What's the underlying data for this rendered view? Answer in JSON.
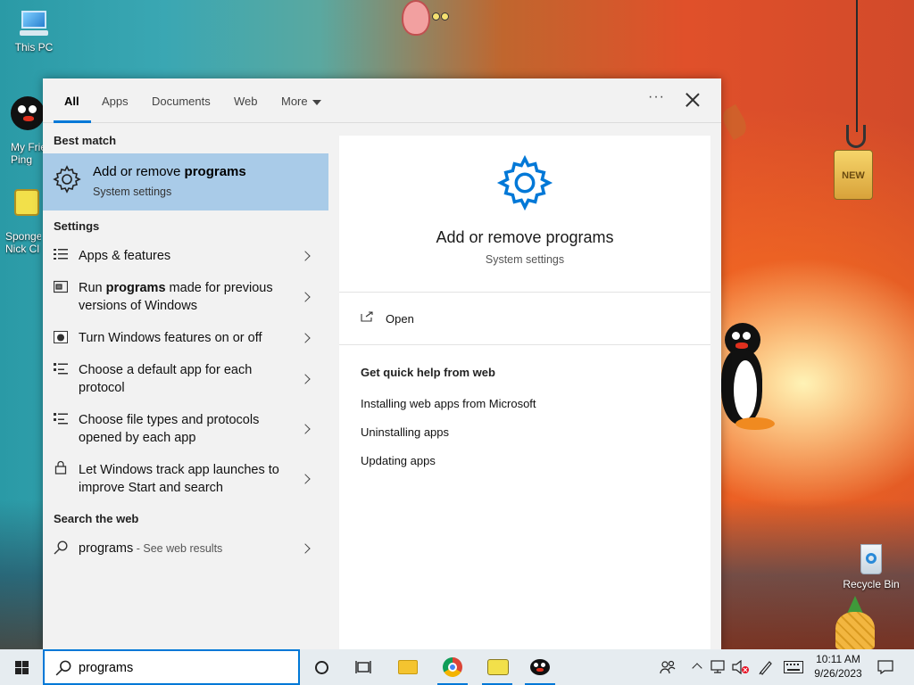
{
  "desktop": {
    "icons": {
      "this_pc": "This PC",
      "my_friend": "My Frie\nPing",
      "sponge": "Sponge\nNick Cl",
      "recycle_bin": "Recycle Bin"
    },
    "sign_text": "NEW"
  },
  "search_panel": {
    "tabs": [
      "All",
      "Apps",
      "Documents",
      "Web",
      "More"
    ],
    "active_tab": "All",
    "best_match": {
      "heading": "Best match",
      "title_plain": "Add or remove ",
      "title_bold": "programs",
      "subtitle": "System settings"
    },
    "settings": {
      "heading": "Settings",
      "items": [
        {
          "text": "Apps & features"
        },
        {
          "pre": "Run ",
          "bold": "programs",
          "post": " made for previous versions of Windows"
        },
        {
          "text": "Turn Windows features on or off"
        },
        {
          "text": "Choose a default app for each protocol"
        },
        {
          "text": "Choose file types and protocols opened by each app"
        },
        {
          "text": "Let Windows track app launches to improve Start and search"
        }
      ]
    },
    "web": {
      "heading": "Search the web",
      "query": "programs",
      "suffix": " - See web results"
    },
    "preview": {
      "title": "Add or remove programs",
      "subtitle": "System settings",
      "open_label": "Open",
      "help_heading": "Get quick help from web",
      "help_links": [
        "Installing web apps from Microsoft",
        "Uninstalling apps",
        "Updating apps"
      ]
    },
    "accent": "#0078d7",
    "highlight": "#a9cbe8"
  },
  "taskbar": {
    "search_value": "programs",
    "clock": {
      "time": "10:11 AM",
      "date": "9/26/2023"
    }
  }
}
